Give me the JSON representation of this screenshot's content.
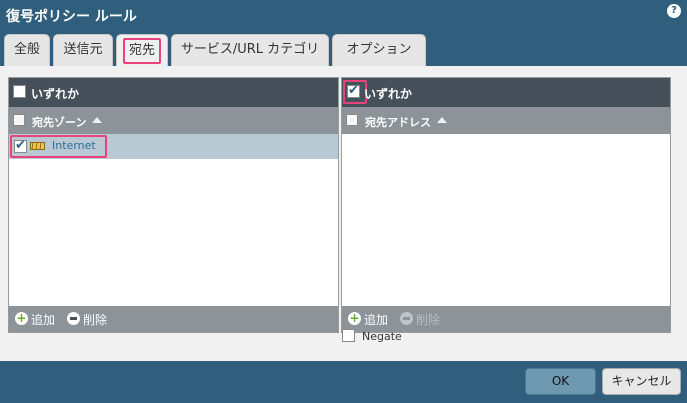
{
  "window": {
    "title": "復号ポリシー ルール"
  },
  "tabs": [
    {
      "label": "全般"
    },
    {
      "label": "送信元"
    },
    {
      "label": "宛先"
    },
    {
      "label": "サービス/URL カテゴリ"
    },
    {
      "label": "オプション"
    }
  ],
  "active_tab": "宛先",
  "left_panel": {
    "any_label": "いずれか",
    "any_checked": false,
    "column_header": "宛先ゾーン",
    "rows": [
      {
        "label": "Internet",
        "checked": true
      }
    ],
    "add_label": "追加",
    "delete_label": "削除"
  },
  "right_panel": {
    "any_label": "いずれか",
    "any_checked": true,
    "column_header": "宛先アドレス",
    "rows": [],
    "add_label": "追加",
    "delete_label": "削除"
  },
  "negate": {
    "label": "Negate",
    "checked": false
  },
  "buttons": {
    "ok": "OK",
    "cancel": "キャンセル"
  },
  "colors": {
    "titlebar": "#2f5f7d",
    "highlight": "#e8437a",
    "panel_header": "#45505a",
    "selected_row": "#b9c9d3"
  }
}
